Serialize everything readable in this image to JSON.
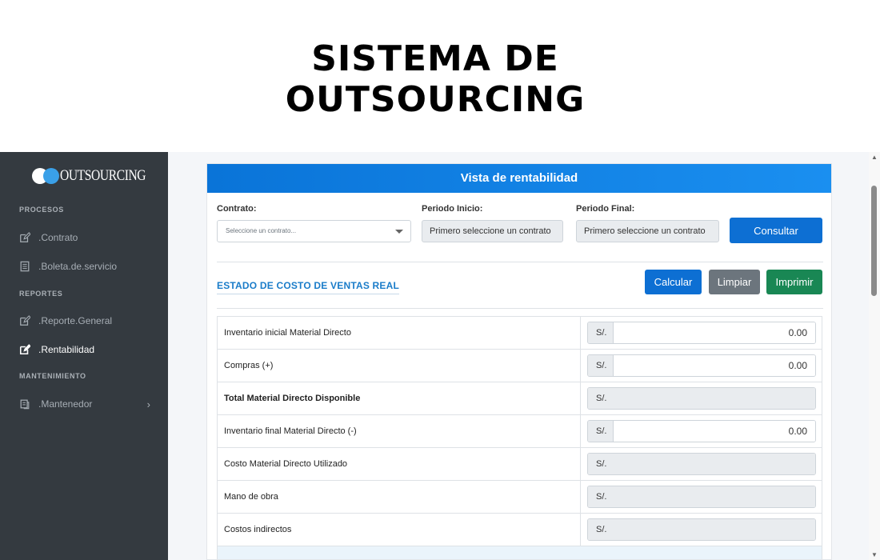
{
  "hero": {
    "title_line1": "SISTEMA DE",
    "title_line2": "OUTSOURCING"
  },
  "sidebar": {
    "brand": "OUTSOURCING",
    "sections": {
      "procesos": "PROCESOS",
      "reportes": "REPORTES",
      "mantenimiento": "MANTENIMIENTO"
    },
    "items": [
      {
        "label": ".Contrato",
        "icon": "edit-icon",
        "active": false
      },
      {
        "label": ".Boleta.de.servicio",
        "icon": "document-icon",
        "active": false
      },
      {
        "label": ".Reporte.General",
        "icon": "edit-icon",
        "active": false
      },
      {
        "label": ".Rentabilidad",
        "icon": "edit-icon",
        "active": true
      },
      {
        "label": ".Mantenedor",
        "icon": "copy-icon",
        "active": false
      }
    ]
  },
  "card": {
    "title": "Vista de rentabilidad",
    "filters": {
      "contrato_label": "Contrato:",
      "contrato_placeholder": "Seleccione un contrato...",
      "inicio_label": "Periodo Inicio:",
      "inicio_value": "Primero seleccione un contrato",
      "final_label": "Periodo Final:",
      "final_value": "Primero seleccione un contrato",
      "consultar": "Consultar"
    },
    "section_title": "ESTADO DE COSTO DE VENTAS REAL",
    "actions": {
      "calcular": "Calcular",
      "limpiar": "Limpiar",
      "imprimir": "Imprimir"
    },
    "currency": "S/.",
    "rows": [
      {
        "label": "Inventario inicial Material Directo",
        "value": "0.00",
        "editable": true,
        "bold": false
      },
      {
        "label": "Compras (+)",
        "value": "0.00",
        "editable": true,
        "bold": false
      },
      {
        "label": "Total Material Directo Disponible",
        "value": "",
        "editable": false,
        "bold": true
      },
      {
        "label": "Inventario final Material Directo (-)",
        "value": "0.00",
        "editable": true,
        "bold": false
      },
      {
        "label": "Costo Material Directo Utilizado",
        "value": "",
        "editable": false,
        "bold": false
      },
      {
        "label": "Mano de obra",
        "value": "",
        "editable": false,
        "bold": false
      },
      {
        "label": "Costos indirectos",
        "value": "",
        "editable": false,
        "bold": false
      }
    ]
  },
  "colors": {
    "sidebar_bg": "#343a40",
    "primary": "#0d6fd3",
    "secondary": "#6c757d",
    "success": "#198754",
    "section_title": "#1a7cc9"
  }
}
